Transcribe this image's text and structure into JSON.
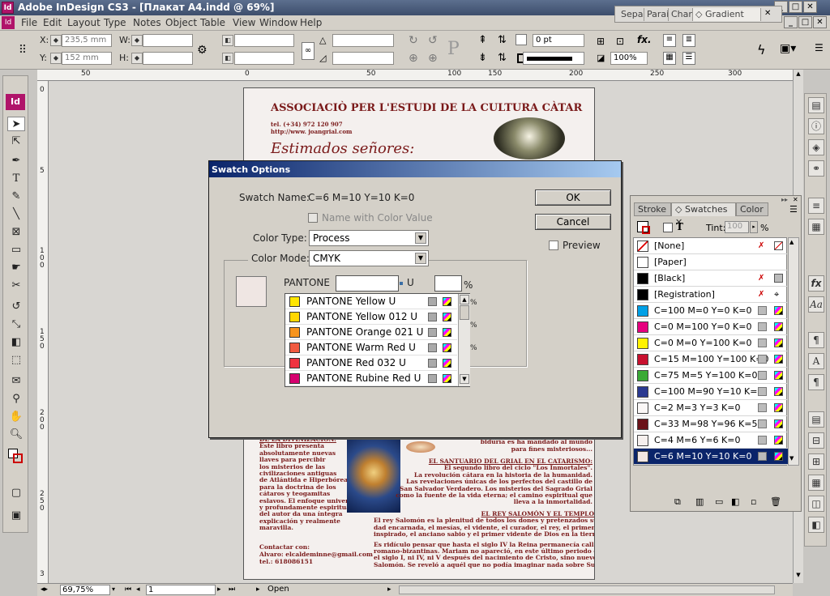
{
  "app": {
    "title": "Adobe InDesign CS3 - [Плакат A4.indd @ 69%]",
    "logo": "Id"
  },
  "menu": [
    "File",
    "Edit",
    "Layout",
    "Type",
    "Notes",
    "Object",
    "Table",
    "View",
    "Window",
    "Help"
  ],
  "control": {
    "x_label": "X:",
    "x_value": "235,5 mm",
    "y_label": "Y:",
    "y_value": "152 mm",
    "w_label": "W:",
    "h_label": "H:",
    "stroke_value": "0 pt",
    "zoom_pct": "100%"
  },
  "top_tabs": [
    "Sepa",
    "Parai",
    "Char",
    "Gradient"
  ],
  "ruler": {
    "h_ticks": [
      "50",
      "0",
      "50",
      "100",
      "150",
      "200",
      "250",
      "300"
    ],
    "v_ticks": [
      "0",
      "5",
      "1 0 0",
      "1 5 0",
      "2 0 0",
      "2 5 0",
      "3"
    ]
  },
  "page": {
    "heading": "ASSOCIACIÒ PER L'ESTUDI DE LA CULTURA CÀTAR",
    "tel": "tel. (+34) 972 120 907",
    "web": "http://www. joangrial.com",
    "greeting": "Estimados señores:",
    "col1": [
      "DE LA DIVINIZACIÓN:",
      "Este libro presenta",
      "absolutamente nuevas",
      "llaves para percibir",
      "los misterios de las",
      "civilizaciones antiguas",
      "de Atlántida e Hiperbórea,",
      "para la doctrina de los",
      "cátaros y teogamitas",
      "eslavos. El enfoque universal",
      "y profundamente espiritual",
      "del autor da una íntegra",
      "explicación y realmente maravilla."
    ],
    "col2_top": [
      "dividad de misterios. Al",
      "biduría es ha mandado al mundo",
      "para fines misteriosos..."
    ],
    "col2_title": "EL SANTUARIO DEL GRIAL EN EL CATARISMO:",
    "col2": [
      "El segundo libro del ciclo \"Los Inmortales\".",
      "La revolución cátara en la historia de la humanidad.",
      "Las revelaciones únicas de los perfectos del castillo de",
      "San Salvador Verdadero. Los misterios del Sagrado Grial",
      "como la fuente de la vida eterna; el camino espiritual que",
      "lleva a la inmortalidad."
    ],
    "col3_title": "EL REY SALOMÓN Y EL TEMPLO",
    "col3": [
      "El rey Salomón es la plenitud de todos los dones y pretenzados superiores d",
      "dad encarnada, el mesías, el vidente, el curador, el rey, el primer sacerdote",
      "inspirado, el anciano sabio y el primer vidente de Dios en la tierra (que es",
      "Es ridículo pensar que hasta el siglo IV la Reina permanecía callada, c",
      "romano-bizantinas. Mariam no apareció, en este último periodo de 6000 a",
      "el siglo I, ni IV, ni V después del nacimiento de Cristo, sino nueve siglos a",
      "Salomón. Se reveló a aquél que no podía imaginar nada sobre Su existe"
    ],
    "contact": [
      "Contactar con:",
      "Alvaro: elcaldeminne@gmail.com",
      "tel.: 618086151"
    ]
  },
  "status": {
    "zoom": "69,75%",
    "page": "1",
    "state": "Open"
  },
  "swatches_panel": {
    "tabs": [
      "Stroke",
      "Swatches",
      "Color"
    ],
    "tint_label": "Tint:",
    "tint_value": "100",
    "pct": "%",
    "items": [
      {
        "name": "[None]",
        "color": "#ffffff"
      },
      {
        "name": "[Paper]",
        "color": "#ffffff"
      },
      {
        "name": "[Black]",
        "color": "#000000"
      },
      {
        "name": "[Registration]",
        "color": "#000000"
      },
      {
        "name": "C=100 M=0 Y=0 K=0",
        "color": "#00a0e6"
      },
      {
        "name": "C=0 M=100 Y=0 K=0",
        "color": "#e6007e"
      },
      {
        "name": "C=0 M=0 Y=100 K=0",
        "color": "#fff200"
      },
      {
        "name": "C=15 M=100 Y=100 K=0",
        "color": "#c8102e"
      },
      {
        "name": "C=75 M=5 Y=100 K=0",
        "color": "#3aaa35"
      },
      {
        "name": "C=100 M=90 Y=10 K=0",
        "color": "#2a3990"
      },
      {
        "name": "C=2 M=3 Y=3 K=0",
        "color": "#fbf8f7"
      },
      {
        "name": "C=33 M=98 Y=96 K=51",
        "color": "#6a1218"
      },
      {
        "name": "C=4 M=6 Y=6 K=0",
        "color": "#f6f0ee"
      },
      {
        "name": "C=6 M=10 Y=10 K=0",
        "color": "#f1e6e3"
      }
    ],
    "selected_index": 13
  },
  "dialog": {
    "title": "Swatch Options",
    "swatch_name_label": "Swatch Name:",
    "swatch_name": "C=6 M=10 Y=10 K=0",
    "name_with_color_value": "Name with Color Value",
    "color_type_label": "Color Type:",
    "color_type": "Process",
    "color_mode_label": "Color Mode:",
    "color_mode": "CMYK",
    "pantone_label": "PANTONE",
    "pantone_suffix": "U",
    "pct": "%",
    "ok": "OK",
    "cancel": "Cancel",
    "preview": "Preview",
    "preview_color": "#efe6e3",
    "pantone_items": [
      {
        "name": "PANTONE Yellow U",
        "color": "#ffe600"
      },
      {
        "name": "PANTONE Yellow 012 U",
        "color": "#ffd700"
      },
      {
        "name": "PANTONE Orange 021 U",
        "color": "#f7941d"
      },
      {
        "name": "PANTONE Warm Red U",
        "color": "#f15a40"
      },
      {
        "name": "PANTONE Red 032 U",
        "color": "#ef3340"
      },
      {
        "name": "PANTONE Rubine Red U",
        "color": "#d6006f"
      }
    ]
  }
}
